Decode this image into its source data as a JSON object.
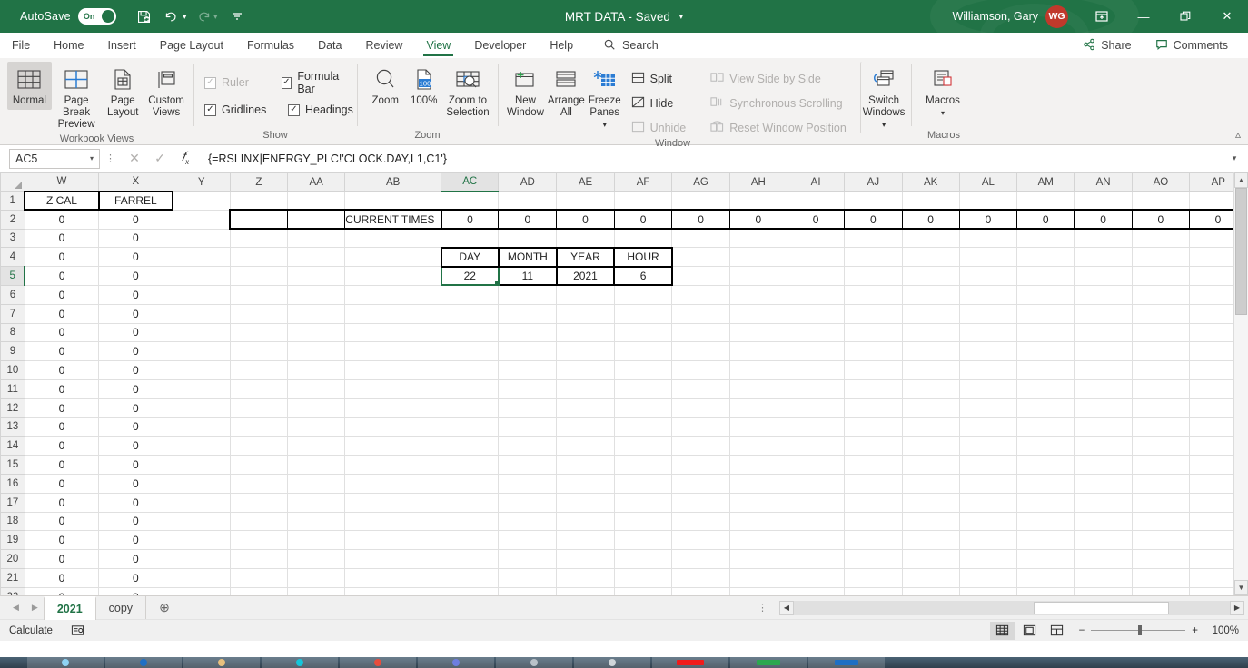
{
  "title_bar": {
    "autosave_label": "AutoSave",
    "autosave_state": "On",
    "document_title": "MRT DATA  -  Saved",
    "save_icon": "save-icon",
    "undo_icon": "undo-icon",
    "redo_icon": "redo-icon",
    "customize_icon": "customize-quick-access-icon",
    "user_name": "Williamson, Gary",
    "user_initials": "WG",
    "ribbon_display_icon": "ribbon-display-options-icon",
    "minimize_label": "—",
    "restore_label": "❐",
    "close_label": "✕",
    "accent_color": "#217346",
    "avatar_color": "#c0392b"
  },
  "ribbon_tabs": {
    "tabs": [
      {
        "label": "File",
        "active": false
      },
      {
        "label": "Home",
        "active": false
      },
      {
        "label": "Insert",
        "active": false
      },
      {
        "label": "Page Layout",
        "active": false
      },
      {
        "label": "Formulas",
        "active": false
      },
      {
        "label": "Data",
        "active": false
      },
      {
        "label": "Review",
        "active": false
      },
      {
        "label": "View",
        "active": true
      },
      {
        "label": "Developer",
        "active": false
      },
      {
        "label": "Help",
        "active": false
      }
    ],
    "search_label": "Search",
    "share_label": "Share",
    "comments_label": "Comments"
  },
  "ribbon": {
    "groups": [
      {
        "name": "Workbook Views",
        "buttons": [
          {
            "label": "Normal",
            "icon": "normal-view-icon",
            "selected": true
          },
          {
            "label": "Page Break Preview",
            "icon": "page-break-preview-icon",
            "selected": false
          },
          {
            "label": "Page Layout",
            "icon": "page-layout-icon",
            "selected": false
          },
          {
            "label": "Custom Views",
            "icon": "custom-views-icon",
            "selected": false
          }
        ]
      },
      {
        "name": "Show",
        "checkboxes": [
          {
            "label": "Ruler",
            "checked": true,
            "disabled": true
          },
          {
            "label": "Formula Bar",
            "checked": true,
            "disabled": false
          },
          {
            "label": "Gridlines",
            "checked": true,
            "disabled": false
          },
          {
            "label": "Headings",
            "checked": true,
            "disabled": false
          }
        ]
      },
      {
        "name": "Zoom",
        "buttons": [
          {
            "label": "Zoom",
            "icon": "zoom-icon"
          },
          {
            "label": "100%",
            "icon": "zoom-100-icon"
          },
          {
            "label": "Zoom to Selection",
            "icon": "zoom-to-selection-icon"
          }
        ]
      },
      {
        "name": "Window",
        "buttons": [
          {
            "label": "New Window",
            "icon": "new-window-icon"
          },
          {
            "label": "Arrange All",
            "icon": "arrange-all-icon"
          },
          {
            "label": "Freeze Panes",
            "icon": "freeze-panes-icon"
          }
        ],
        "small_left": [
          {
            "label": "Split",
            "icon": "split-icon",
            "disabled": false
          },
          {
            "label": "Hide",
            "icon": "hide-icon",
            "disabled": false
          },
          {
            "label": "Unhide",
            "icon": "unhide-icon",
            "disabled": true
          }
        ],
        "small_right": [
          {
            "label": "View Side by Side",
            "icon": "view-side-by-side-icon",
            "disabled": true
          },
          {
            "label": "Synchronous Scrolling",
            "icon": "synchronous-scrolling-icon",
            "disabled": true
          },
          {
            "label": "Reset Window Position",
            "icon": "reset-window-position-icon",
            "disabled": true
          }
        ],
        "switch_windows": {
          "label": "Switch Windows",
          "icon": "switch-windows-icon"
        }
      },
      {
        "name": "Macros",
        "buttons": [
          {
            "label": "Macros",
            "icon": "macros-icon"
          }
        ]
      }
    ],
    "collapse_icon": "collapse-ribbon-icon"
  },
  "formula_bar": {
    "name_box_value": "AC5",
    "cancel_icon": "cancel-icon",
    "enter_icon": "enter-icon",
    "function_icon": "insert-function-icon",
    "formula_value": "{=RSLINX|ENERGY_PLC!'CLOCK.DAY,L1,C1'}",
    "expand_icon": "expand-formula-bar-icon"
  },
  "grid": {
    "columns": [
      "W",
      "X",
      "Y",
      "Z",
      "AA",
      "AB",
      "AC",
      "AD",
      "AE",
      "AF",
      "AG",
      "AH",
      "AI",
      "AJ",
      "AK",
      "AL",
      "AM",
      "AN",
      "AO",
      "AP"
    ],
    "active_column": "AC",
    "active_row": 5,
    "selected_cell": "AC5",
    "rows": [
      1,
      2,
      3,
      4,
      5,
      6,
      7,
      8,
      9,
      10,
      11,
      12,
      13,
      14,
      15,
      16,
      17,
      18,
      19,
      20,
      21,
      22
    ],
    "cells": {
      "W1": "Z CAL",
      "X1": "FARREL",
      "AA2": "CURRENT TIMES",
      "AC4": "DAY",
      "AD4": "MONTH",
      "AE4": "YEAR",
      "AF4": "HOUR",
      "AC5": "22",
      "AD5": "11",
      "AE5": "2021",
      "AF5": "6"
    },
    "w_column_values": [
      "0",
      "0",
      "0",
      "0",
      "0",
      "0",
      "0",
      "0",
      "0",
      "0",
      "0",
      "0",
      "0",
      "0",
      "0",
      "0",
      "0",
      "0",
      "0",
      "0",
      "0"
    ],
    "x_column_values": [
      "0",
      "0",
      "0",
      "0",
      "0",
      "0",
      "0",
      "0",
      "0",
      "0",
      "0",
      "0",
      "0",
      "0",
      "0",
      "0",
      "0",
      "0",
      "0",
      "0",
      "0"
    ],
    "row2_zero_columns": [
      "AC",
      "AD",
      "AE",
      "AF",
      "AG",
      "AH",
      "AI",
      "AJ",
      "AK",
      "AL",
      "AM",
      "AN",
      "AO",
      "AP"
    ],
    "row2_zero_value": "0"
  },
  "sheet_bar": {
    "prev_icon": "previous-sheet-icon",
    "next_icon": "next-sheet-icon",
    "tabs": [
      {
        "label": "2021",
        "active": true
      },
      {
        "label": "copy",
        "active": false
      }
    ],
    "add_sheet_icon": "add-sheet-icon"
  },
  "status_bar": {
    "status_text": "Calculate",
    "accessibility_icon": "accessibility-checker-icon",
    "view_buttons": [
      {
        "icon": "normal-view-icon",
        "active": true
      },
      {
        "icon": "page-layout-view-icon",
        "active": false
      },
      {
        "icon": "page-break-preview-view-icon",
        "active": false
      }
    ],
    "zoom_out_label": "−",
    "zoom_in_label": "+",
    "zoom_level": "100%"
  }
}
